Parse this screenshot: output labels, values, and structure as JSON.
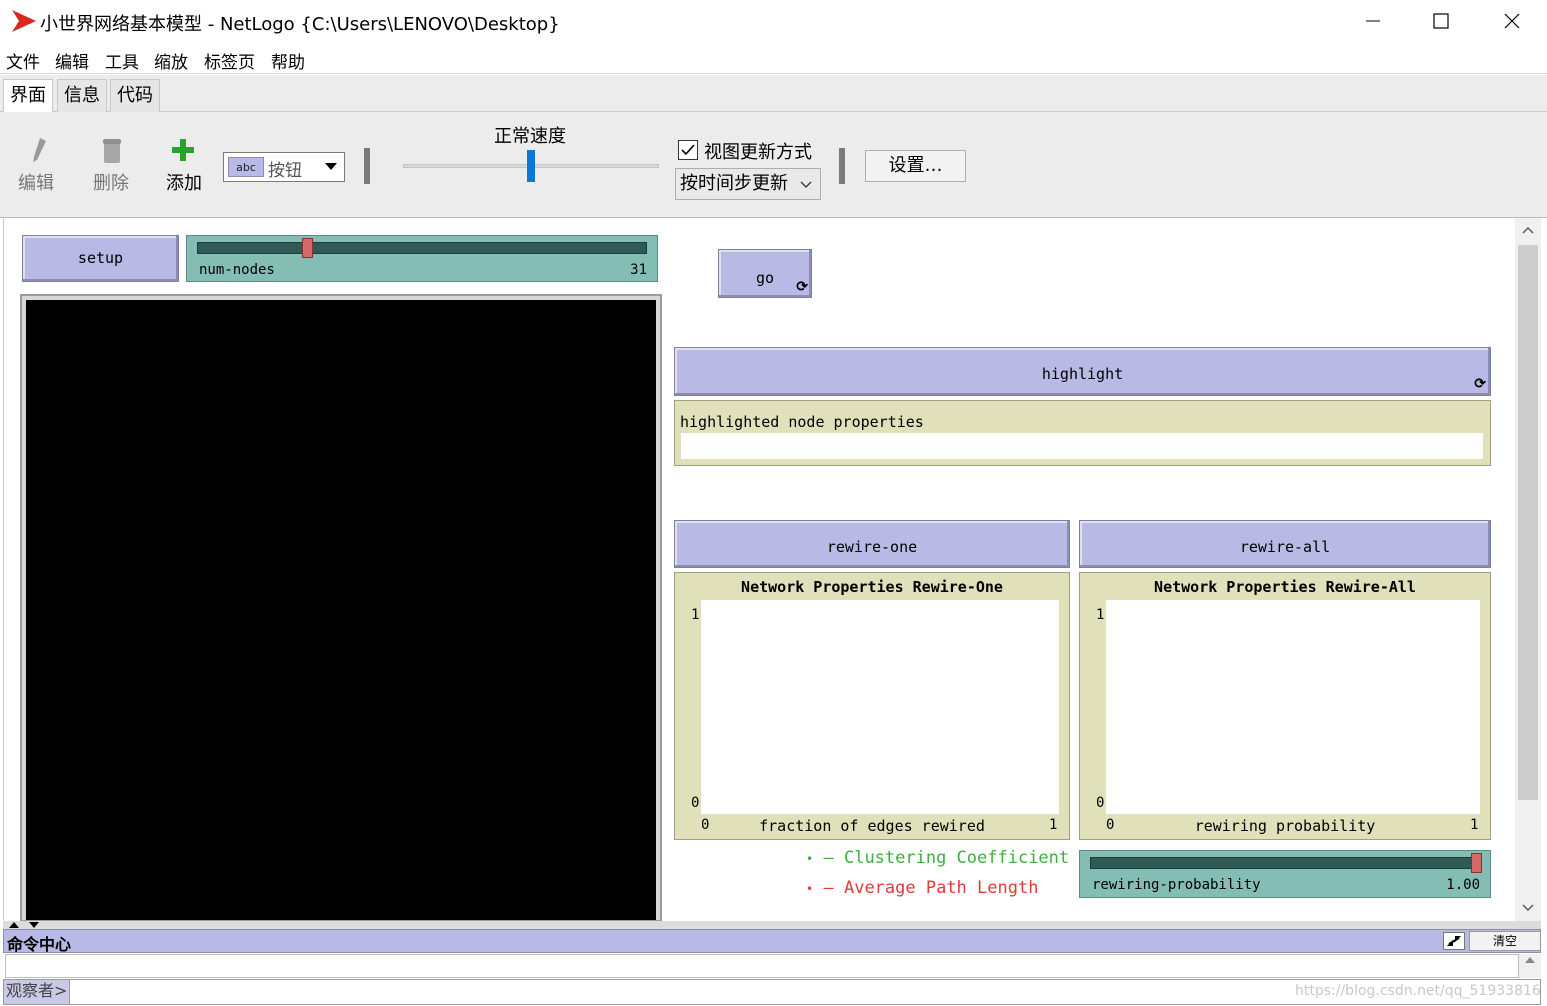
{
  "window": {
    "title": "小世界网络基本模型 - NetLogo {C:\\Users\\LENOVO\\Desktop}",
    "minimize_icon": "minimize-icon",
    "maximize_icon": "maximize-icon",
    "close_icon": "close-icon"
  },
  "menu": [
    "文件",
    "编辑",
    "工具",
    "缩放",
    "标签页",
    "帮助"
  ],
  "tabs": [
    "界面",
    "信息",
    "代码"
  ],
  "toolbar": {
    "edit_label": "编辑",
    "delete_label": "删除",
    "add_label": "添加",
    "widget_type": "按钮",
    "widget_type_icon_text": "abc",
    "speed_label": "正常速度",
    "view_updates_label": "视图更新方式",
    "view_updates_checked": true,
    "update_mode": "按时间步更新",
    "settings_label": "设置…",
    "speed_value": 0.5
  },
  "widgets": {
    "setup_label": "setup",
    "go_label": "go",
    "num_nodes": {
      "label": "num-nodes",
      "value": "31",
      "fraction": 0.24
    },
    "highlight_label": "highlight",
    "monitor_label": "highlighted node properties",
    "monitor_value": "",
    "rewire_one_label": "rewire-one",
    "rewire_all_label": "rewire-all",
    "rewiring_probability": {
      "label": "rewiring-probability",
      "value": "1.00",
      "fraction": 1.0
    },
    "legend": [
      {
        "name": "Clustering Coefficient",
        "color": "#3fae3f"
      },
      {
        "name": "Average Path Length",
        "color": "#e03a3a"
      }
    ]
  },
  "chart_data": [
    {
      "type": "line",
      "title": "Network Properties Rewire-One",
      "xlabel": "fraction of edges rewired",
      "ylabel": "",
      "xlim": [
        0,
        1
      ],
      "ylim": [
        0,
        1
      ],
      "x_ticks": [
        "0",
        "1"
      ],
      "y_ticks": [
        "0",
        "1"
      ],
      "series": []
    },
    {
      "type": "line",
      "title": "Network Properties Rewire-All",
      "xlabel": "rewiring probability",
      "ylabel": "",
      "xlim": [
        0,
        1
      ],
      "ylim": [
        0,
        1
      ],
      "x_ticks": [
        "0",
        "1"
      ],
      "y_ticks": [
        "0",
        "1"
      ],
      "series": []
    }
  ],
  "command_center": {
    "title": "命令中心",
    "clear_label": "清空",
    "prompt": "观察者>",
    "input_value": ""
  },
  "watermark": "https://blog.csdn.net/qq_51933816",
  "colors": {
    "button": "#b9b9e5",
    "slider": "#84bdb3",
    "monitor": "#e0e0bb",
    "view_bg": "#000000",
    "add_icon": "#2aa12a"
  }
}
